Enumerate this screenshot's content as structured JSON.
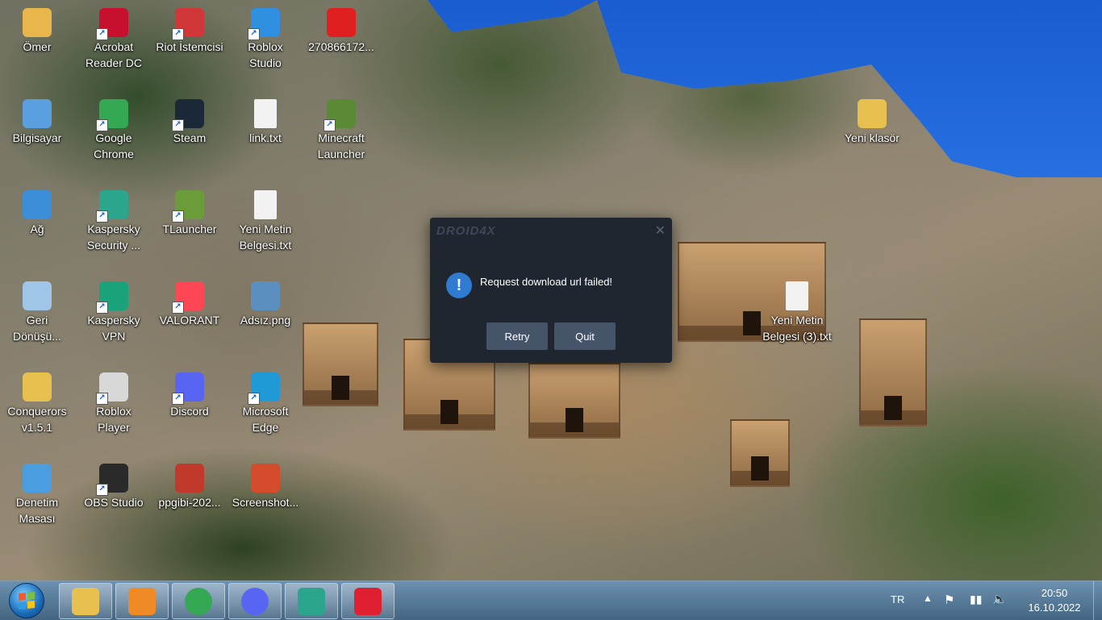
{
  "desktop": {
    "icons": [
      {
        "label": "Ömer",
        "icon": "user-folder-icon",
        "color": "#e8b64a"
      },
      {
        "label": "Acrobat\nReader DC",
        "icon": "acrobat-icon",
        "color": "#c8102e"
      },
      {
        "label": "Riot İstemcisi",
        "icon": "riot-client-icon",
        "color": "#d13639"
      },
      {
        "label": "Roblox\nStudio",
        "icon": "roblox-studio-icon",
        "color": "#2f8fe0"
      },
      {
        "label": "270866172...",
        "icon": "app-icon",
        "color": "#e02020"
      },
      {
        "label": "Bilgisayar",
        "icon": "computer-icon",
        "color": "#5aa0e0"
      },
      {
        "label": "Google\nChrome",
        "icon": "chrome-icon",
        "color": "#34a853"
      },
      {
        "label": "Steam",
        "icon": "steam-icon",
        "color": "#1b2838"
      },
      {
        "label": "link.txt",
        "icon": "text-file-icon",
        "color": "#f2f2f2"
      },
      {
        "label": "Minecraft\nLauncher",
        "icon": "minecraft-icon",
        "color": "#5a8a34"
      },
      {
        "label": "Ağ",
        "icon": "network-icon",
        "color": "#3c8ed8"
      },
      {
        "label": "Kaspersky\nSecurity ...",
        "icon": "kaspersky-icon",
        "color": "#2ba58c"
      },
      {
        "label": "TLauncher",
        "icon": "tlauncher-icon",
        "color": "#6a9c3a"
      },
      {
        "label": "Yeni Metin\nBelgesi.txt",
        "icon": "text-file-icon",
        "color": "#f2f2f2"
      },
      {
        "label": "Geri\nDönüşü...",
        "icon": "recycle-bin-icon",
        "color": "#9fc6e8"
      },
      {
        "label": "Kaspersky\nVPN",
        "icon": "kaspersky-vpn-icon",
        "color": "#1aa37a"
      },
      {
        "label": "VALORANT",
        "icon": "valorant-icon",
        "color": "#ff4655"
      },
      {
        "label": "Adsız.png",
        "icon": "image-file-icon",
        "color": "#5b8fbf"
      },
      {
        "label": "Conquerors\nv1.5.1",
        "icon": "folder-icon",
        "color": "#e8c050"
      },
      {
        "label": "Roblox\nPlayer",
        "icon": "roblox-icon",
        "color": "#d8d8d8"
      },
      {
        "label": "Discord",
        "icon": "discord-icon",
        "color": "#5865f2"
      },
      {
        "label": "Microsoft\nEdge",
        "icon": "edge-icon",
        "color": "#1f9ad6"
      },
      {
        "label": "Denetim\nMasası",
        "icon": "control-panel-icon",
        "color": "#4a9ee0"
      },
      {
        "label": "OBS Studio",
        "icon": "obs-icon",
        "color": "#2a2a2a"
      },
      {
        "label": "ppgibi-202...",
        "icon": "image-file-icon",
        "color": "#c0392b"
      },
      {
        "label": "Screenshot...",
        "icon": "image-file-icon",
        "color": "#d44c2c"
      },
      {
        "label": "Yeni klasör",
        "icon": "folder-icon",
        "color": "#e8c050"
      },
      {
        "label": "Yeni Metin\nBelgesi (3).txt",
        "icon": "text-file-icon",
        "color": "#f2f2f2"
      }
    ]
  },
  "dialog": {
    "brand": "DROID4X",
    "message": "Request download url failed!",
    "retry_label": "Retry",
    "quit_label": "Quit",
    "close_glyph": "✕"
  },
  "taskbar": {
    "pinned": [
      {
        "name": "explorer",
        "icon": "file-explorer-icon",
        "color": "#e8c050"
      },
      {
        "name": "media-player",
        "icon": "media-player-icon",
        "color": "#f08a24"
      },
      {
        "name": "chrome",
        "icon": "chrome-icon",
        "color": "#34a853"
      },
      {
        "name": "discord",
        "icon": "discord-icon",
        "color": "#5865f2"
      },
      {
        "name": "kaspersky",
        "icon": "kaspersky-icon",
        "color": "#2ba58c"
      },
      {
        "name": "droid4x",
        "icon": "droid4x-icon",
        "color": "#e02030"
      }
    ],
    "tray": {
      "language": "TR",
      "time": "20:50",
      "date": "16.10.2022"
    }
  }
}
